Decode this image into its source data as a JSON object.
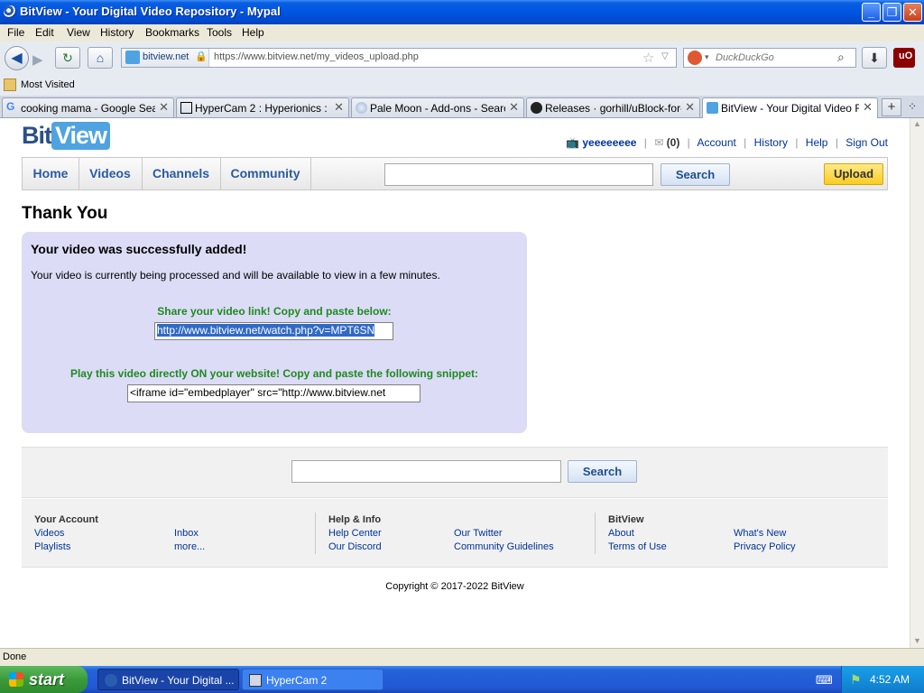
{
  "window": {
    "title": "BitView - Your Digital Video Repository - Mypal"
  },
  "menu": [
    "File",
    "Edit",
    "View",
    "History",
    "Bookmarks",
    "Tools",
    "Help"
  ],
  "navbar": {
    "identity_domain": "bitview.net",
    "url": "https://www.bitview.net/my_videos_upload.php",
    "search_placeholder": "DuckDuckGo"
  },
  "bookmarks": {
    "most_visited": "Most Visited"
  },
  "tabs": [
    {
      "label": "cooking mama - Google Search"
    },
    {
      "label": "HyperCam 2 : Hyperionics : F..."
    },
    {
      "label": "Pale Moon - Add-ons - Search..."
    },
    {
      "label": "Releases · gorhill/uBlock-for-f..."
    },
    {
      "label": "BitView - Your Digital Video R..."
    }
  ],
  "site": {
    "logo_bit": "Bit",
    "logo_view": "View",
    "username": "yeeeeeeee",
    "inbox_count": "(0)",
    "top_links": {
      "account": "Account",
      "history": "History",
      "help": "Help",
      "sign_out": "Sign Out"
    },
    "nav": {
      "home": "Home",
      "videos": "Videos",
      "channels": "Channels",
      "community": "Community"
    },
    "search_button": "Search",
    "upload_button": "Upload"
  },
  "content": {
    "page_title": "Thank You",
    "success_heading": "Your video was successfully added!",
    "success_text": "Your video is currently being processed and will be available to view in a few minutes.",
    "share_label": "Share your video link! Copy and paste below:",
    "share_link": "http://www.bitview.net/watch.php?v=MPT6SN",
    "embed_label": "Play this video directly ON your website! Copy and paste the following snippet:",
    "embed_snippet": "<iframe id=\"embedplayer\" src=\"http://www.bitview.net"
  },
  "footer": {
    "search_button": "Search",
    "your_account": {
      "heading": "Your Account",
      "videos": "Videos",
      "playlists": "Playlists",
      "inbox": "Inbox",
      "more": "more..."
    },
    "help_info": {
      "heading": "Help & Info",
      "help_center": "Help Center",
      "our_discord": "Our Discord",
      "our_twitter": "Our Twitter",
      "community_guidelines": "Community Guidelines"
    },
    "bitview": {
      "heading": "BitView",
      "about": "About",
      "terms": "Terms of Use",
      "whats_new": "What's New",
      "privacy": "Privacy Policy"
    },
    "copyright": "Copyright © 2017-2022 BitView"
  },
  "statusbar": {
    "text": "Done"
  },
  "taskbar": {
    "start": "start",
    "items": [
      {
        "label": "BitView - Your Digital ..."
      },
      {
        "label": "HyperCam 2"
      }
    ],
    "clock": "4:52 AM"
  }
}
